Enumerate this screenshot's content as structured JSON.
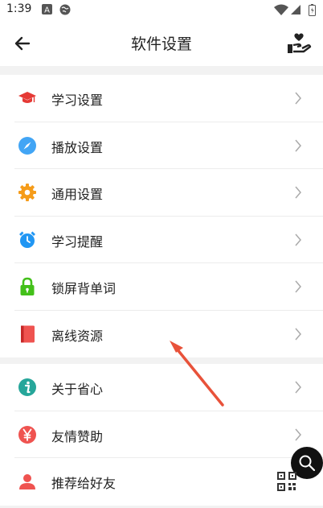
{
  "status_bar": {
    "time": "1:39",
    "icons": [
      "a-box-icon",
      "globe-icon",
      "wifi-icon",
      "signal-icon",
      "battery-icon"
    ]
  },
  "header": {
    "title": "软件设置",
    "back_icon": "arrow-left-icon",
    "action_icon": "hand-heart-icon"
  },
  "settings": {
    "group1": [
      {
        "label": "学习设置",
        "icon": "graduation-cap-icon",
        "color": "#e53935"
      },
      {
        "label": "播放设置",
        "icon": "compass-icon",
        "color": "#42a5f5"
      },
      {
        "label": "通用设置",
        "icon": "gear-icon",
        "color": "#f59c1a"
      },
      {
        "label": "学习提醒",
        "icon": "alarm-clock-icon",
        "color": "#2196f3"
      },
      {
        "label": "锁屏背单词",
        "icon": "lock-icon",
        "color": "#43c01a"
      },
      {
        "label": "离线资源",
        "icon": "book-icon",
        "color": "#ef5350"
      }
    ],
    "group2": [
      {
        "label": "关于省心",
        "icon": "info-icon",
        "color": "#26a69a"
      },
      {
        "label": "友情赞助",
        "icon": "yen-icon",
        "color": "#ef5350"
      },
      {
        "label": "推荐给好友",
        "icon": "person-icon",
        "color": "#ef5350"
      }
    ]
  },
  "floating": {
    "search_icon": "search-icon",
    "qr_icon": "qr-code-icon"
  },
  "colors": {
    "background": "#f2f2f2",
    "annotation_arrow": "#e8523a"
  }
}
